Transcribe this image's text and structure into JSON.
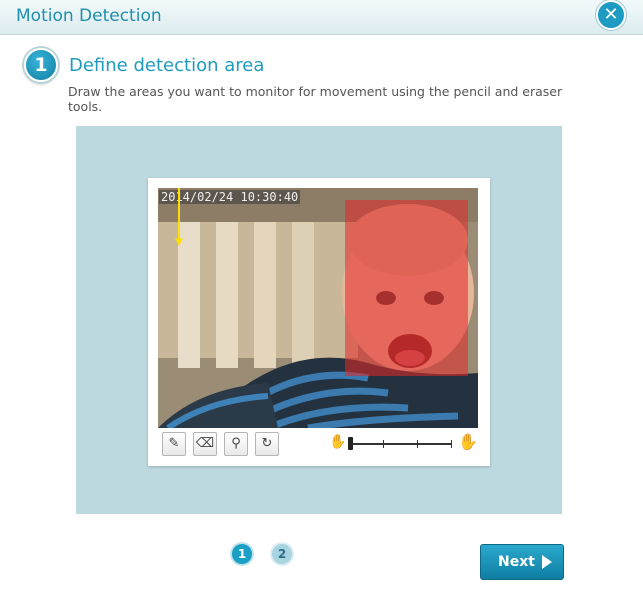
{
  "dialog": {
    "title": "Motion Detection",
    "close_icon": "close-icon"
  },
  "step": {
    "number": "1",
    "title": "Define detection area",
    "description": "Draw the areas you want to monitor for movement using the pencil and eraser tools."
  },
  "camera": {
    "timestamp": "2014/02/24 10:30:40",
    "detection_color": "#e62828"
  },
  "toolbar": {
    "tools": [
      "pencil-icon",
      "eraser-icon",
      "broom-icon",
      "refresh-icon"
    ],
    "sensitivity_icons": [
      "small-hand-icon",
      "large-hand-icon"
    ]
  },
  "pagination": {
    "pages": [
      "1",
      "2"
    ],
    "current": "1"
  },
  "footer": {
    "next_label": "Next"
  },
  "colors": {
    "accent": "#1a9fc6",
    "panel_bg": "#bcd9df"
  }
}
